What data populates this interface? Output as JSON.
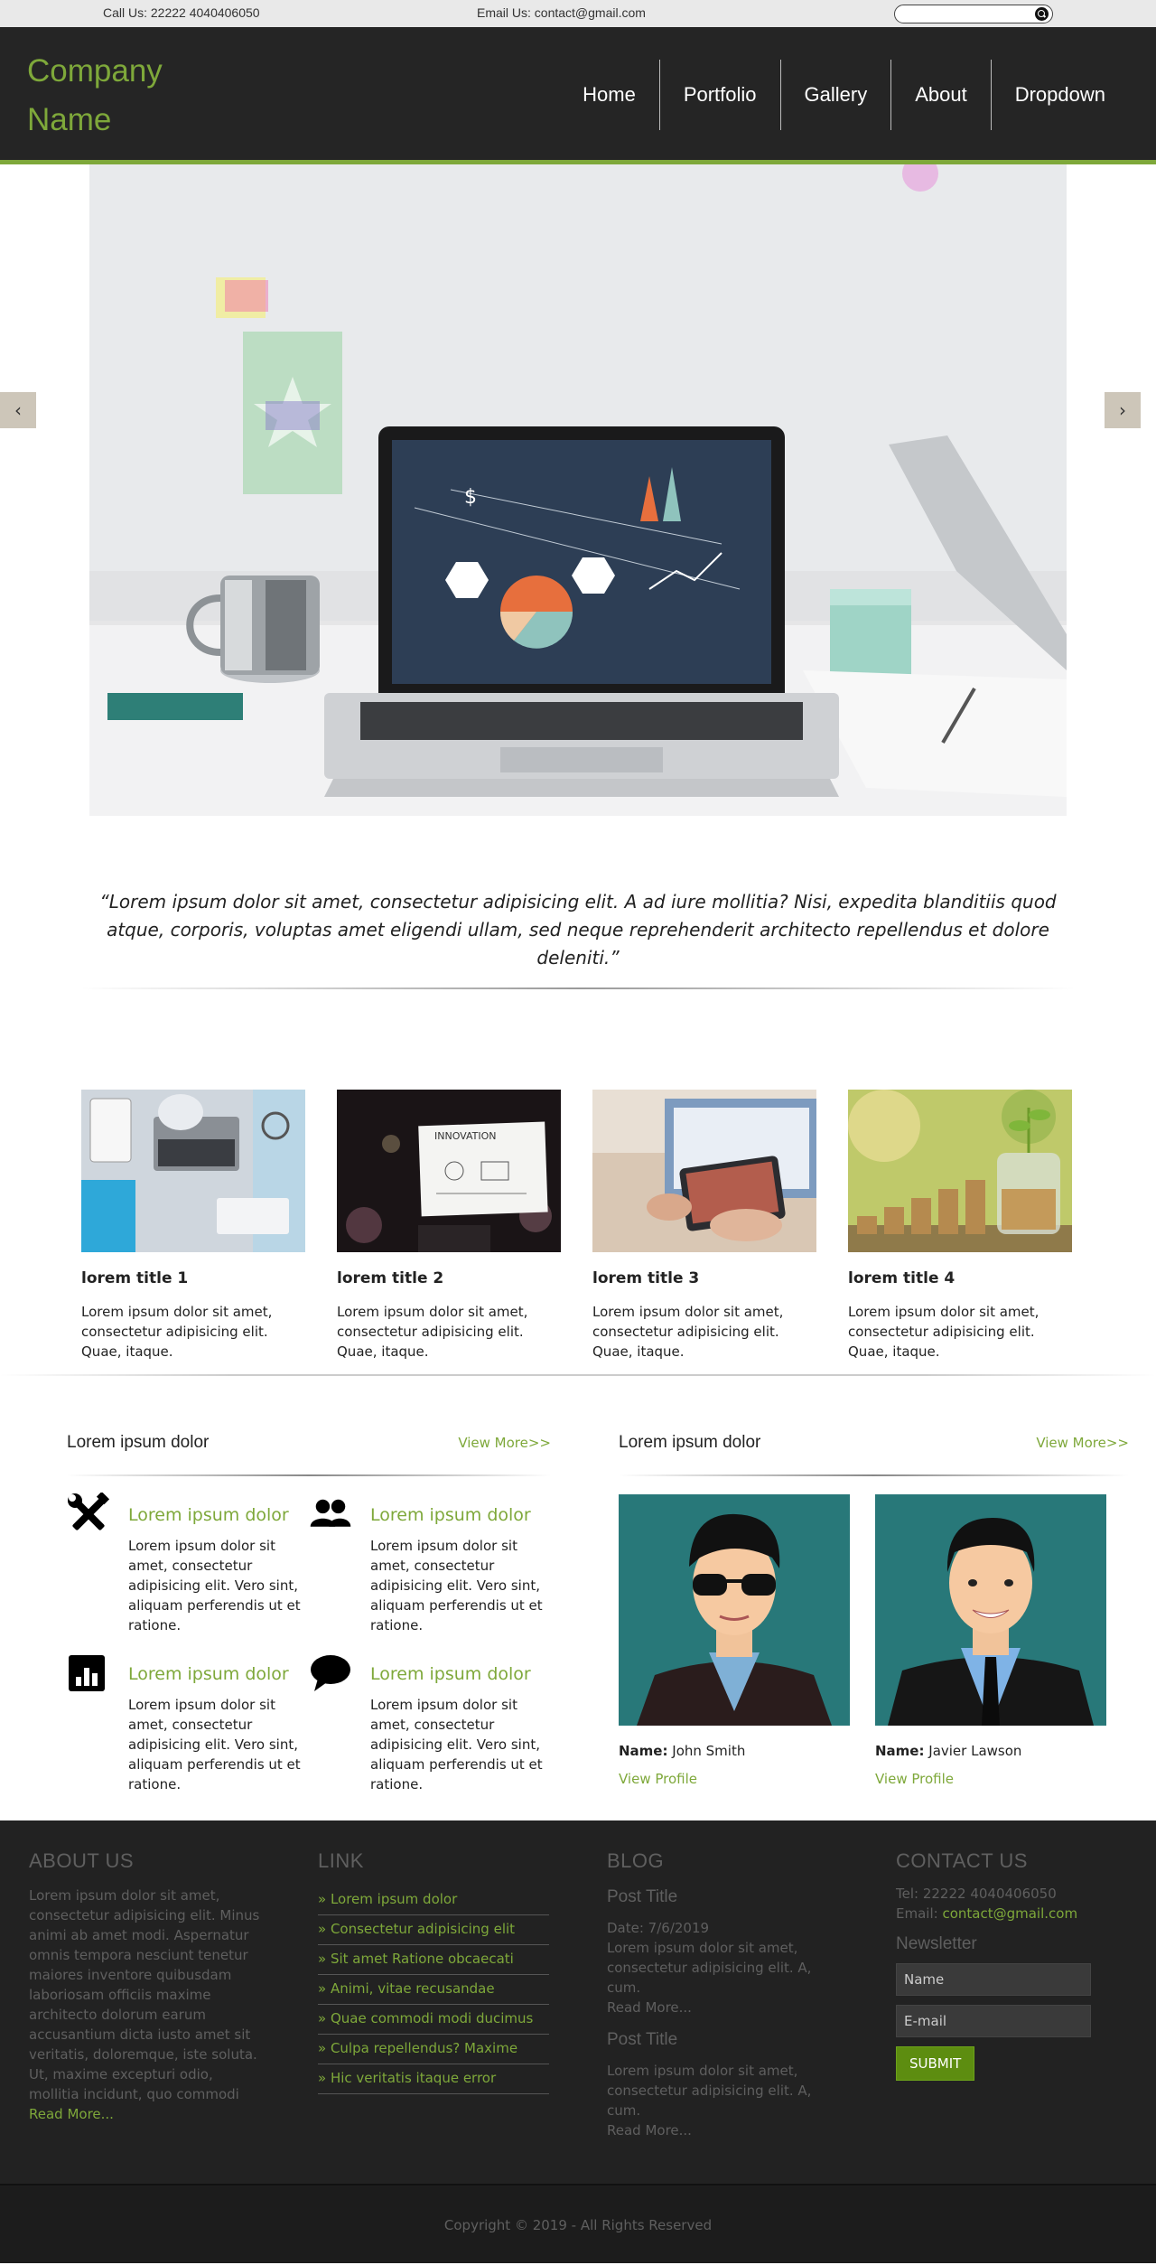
{
  "topbar": {
    "call": "Call Us: 22222 4040406050",
    "email": "Email Us: contact@gmail.com",
    "search_placeholder": ""
  },
  "header": {
    "logo": "Company Name",
    "nav": [
      "Home",
      "Portfolio",
      "Gallery",
      "About",
      "Dropdown"
    ]
  },
  "slider": {
    "prev": "‹",
    "next": "›"
  },
  "quote": "“Lorem ipsum dolor sit amet, consectetur adipisicing elit. A ad iure mollitia? Nisi, expedita blanditiis quod atque, corporis, voluptas amet eligendi ullam, sed neque reprehenderit architecto repellendus et dolore deleniti.”",
  "cards": [
    {
      "title": "lorem title 1",
      "text": "Lorem ipsum dolor sit amet, consectetur adipisicing elit. Quae, itaque."
    },
    {
      "title": "lorem title 2",
      "text": "Lorem ipsum dolor sit amet, consectetur adipisicing elit. Quae, itaque."
    },
    {
      "title": "lorem title 3",
      "text": "Lorem ipsum dolor sit amet, consectetur adipisicing elit. Quae, itaque."
    },
    {
      "title": "lorem title 4",
      "text": "Lorem ipsum dolor sit amet, consectetur adipisicing elit. Quae, itaque."
    }
  ],
  "features": {
    "title": "Lorem ipsum dolor",
    "more": "View More>>",
    "items": [
      {
        "icon": "tools-icon",
        "title": "Lorem ipsum dolor",
        "text": "Lorem ipsum dolor sit amet, consectetur adipisicing elit. Vero sint, aliquam perferendis ut et ratione."
      },
      {
        "icon": "users-icon",
        "title": "Lorem ipsum dolor",
        "text": "Lorem ipsum dolor sit amet, consectetur adipisicing elit. Vero sint, aliquam perferendis ut et ratione."
      },
      {
        "icon": "bar-chart-icon",
        "title": "Lorem ipsum dolor",
        "text": "Lorem ipsum dolor sit amet, consectetur adipisicing elit. Vero sint, aliquam perferendis ut et ratione."
      },
      {
        "icon": "chat-bubble-icon",
        "title": "Lorem ipsum dolor",
        "text": "Lorem ipsum dolor sit amet, consectetur adipisicing elit. Vero sint, aliquam perferendis ut et ratione."
      }
    ]
  },
  "team": {
    "title": "Lorem ipsum dolor",
    "more": "View More>>",
    "name_label": "Name:",
    "profile_label": "View Profile",
    "people": [
      {
        "name": "John Smith"
      },
      {
        "name": "Javier Lawson"
      }
    ]
  },
  "footer": {
    "about": {
      "title": "ABOUT US",
      "text": "Lorem ipsum dolor sit amet, consectetur adipisicing elit. Minus animi ab amet modi. Aspernatur omnis tempora nesciunt tenetur maiores inventore quibusdam laboriosam officiis maxime architecto dolorum earum accusantium dicta iusto amet sit veritatis, doloremque, iste soluta. Ut, maxime excepturi odio, mollitia incidunt, quo commodi",
      "read_more": "Read More..."
    },
    "links": {
      "title": "LINK",
      "items": [
        "» Lorem ipsum dolor",
        "» Consectetur adipisicing elit",
        "» Sit amet Ratione obcaecati",
        "» Animi, vitae recusandae",
        "» Quae commodi modi ducimus",
        "» Culpa repellendus? Maxime",
        "» Hic veritatis itaque error"
      ]
    },
    "blog": {
      "title": "BLOG",
      "posts": [
        {
          "title": "Post Title",
          "date": "Date: 7/6/2019",
          "text": "Lorem ipsum dolor sit amet, consectetur adipisicing elit. A, cum.",
          "read_more": "Read More..."
        },
        {
          "title": "Post Title",
          "text": "Lorem ipsum dolor sit amet, consectetur adipisicing elit. A, cum.",
          "read_more": "Read More..."
        }
      ]
    },
    "contact": {
      "title": "CONTACT US",
      "tel": "Tel: 22222 4040406050",
      "email_label": "Email: ",
      "email": "contact@gmail.com",
      "newsletter": "Newsletter",
      "name_placeholder": "Name",
      "email_placeholder": "E-mail",
      "submit": "SUBMIT"
    },
    "copyright": "Copyright © 2019 - All Rights Reserved"
  },
  "colors": {
    "accent": "#7ea83a",
    "header_bg": "#252525",
    "footer_bg": "#222222",
    "submit_bg": "#5d8d10"
  }
}
